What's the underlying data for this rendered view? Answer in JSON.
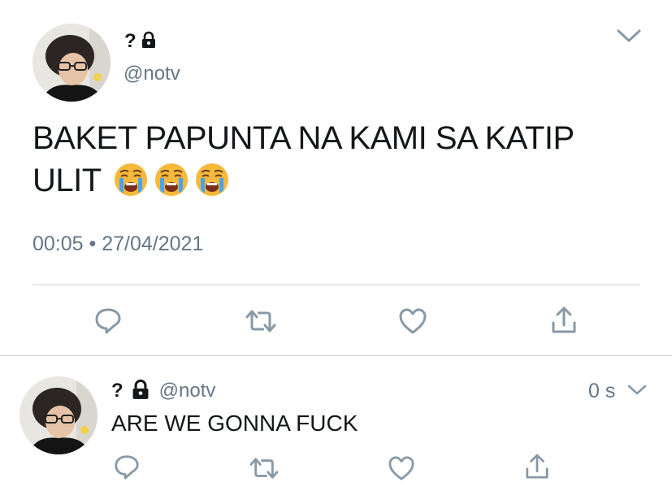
{
  "tweet": {
    "display_name": "?",
    "handle": "@notv",
    "text_line1": "BAKET PAPUNTA NA KAMI SA KATIP",
    "text_line2": "ULIT",
    "emojis": [
      "loudly-crying-face",
      "loudly-crying-face",
      "loudly-crying-face"
    ],
    "time": "00:05",
    "separator": "•",
    "date": "27/04/2021"
  },
  "actions": [
    "reply-icon",
    "retweet-icon",
    "like-icon",
    "share-icon"
  ],
  "reply": {
    "display_name": "?",
    "handle": "@notv",
    "time": "0 s",
    "text": "ARE WE GONNA FUCK"
  },
  "colors": {
    "text": "#14171a",
    "muted": "#657786",
    "icon": "#8899a6",
    "divider": "#cfd6dc"
  }
}
